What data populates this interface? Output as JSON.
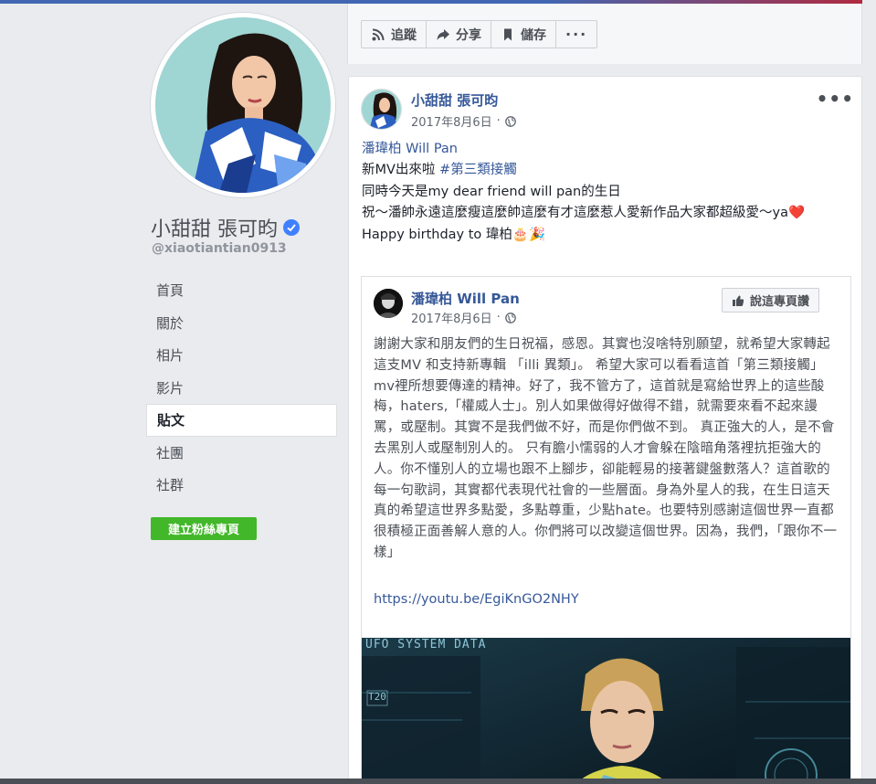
{
  "profile": {
    "name": "小甜甜 張可昀",
    "username": "@xiaotiantian0913"
  },
  "nav": {
    "items": [
      {
        "label": "首頁"
      },
      {
        "label": "關於"
      },
      {
        "label": "相片"
      },
      {
        "label": "影片"
      },
      {
        "label": "貼文"
      },
      {
        "label": "社團"
      },
      {
        "label": "社群"
      }
    ],
    "active_index": 4
  },
  "create_page_label": "建立粉絲專頁",
  "actions": {
    "follow": "追蹤",
    "share": "分享",
    "save": "儲存",
    "more": "···"
  },
  "post": {
    "author": "小甜甜 張可昀",
    "date": "2017年8月6日",
    "more": "•••",
    "lines": {
      "mention": "潘瑋柏 Will Pan",
      "l2a": "新MV出來啦 ",
      "l2b": "#第三類接觸",
      "l3": "同時今天是my dear friend will pan的生日",
      "l4": "祝～潘帥永遠這麼瘦這麼帥這麼有才這麼惹人愛新作品大家都超級愛～ya❤️",
      "l5": "Happy birthday to 瑋柏🎂🎉"
    }
  },
  "shared": {
    "author": "潘瑋柏 Will Pan",
    "date": "2017年8月6日",
    "like_label": "說這專頁讚",
    "body": "謝謝大家和朋友們的生日祝福，感恩。其實也沒啥特別願望，就希望大家轉起這支MV 和支持新專輯 「illi 異類」。 希望大家可以看看這首「第三類接觸」mv裡所想要傳達的精神。好了，我不管方了，這首就是寫給世界上的這些酸梅，haters,「權威人士」。別人如果做得好做得不錯，就需要來看不起來謾罵，或壓制。其實不是我們做不好，而是你們做不到。 真正強大的人，是不會去黑別人或壓制別人的。 只有膽小懦弱的人才會躲在陰暗角落裡抗拒強大的人。你不懂別人的立場也跟不上腳步，卻能輕易的接著鍵盤數落人？這首歌的每一句歌詞，其實都代表現代社會的一些層面。身為外星人的我，在生日這天真的希望這世界多點愛，多點尊重，少點hate。也要特別感謝這個世界一直都很積極正面善解人意的人。你們將可以改變這個世界。因為，我們，「跟你不一樣」",
    "link": "https://youtu.be/EgiKnGO2NHY"
  },
  "video": {
    "overlay_text": "UFO SYSTEM DATA",
    "hud_label": "T20"
  },
  "colors": {
    "brand_blue": "#4267b2",
    "link_blue": "#365899",
    "create_green": "#42b72a",
    "verified_blue": "#4080ff",
    "heart_red": "#e0245e"
  },
  "icons": {
    "follow": "rss-icon",
    "share": "share-arrow-icon",
    "save": "bookmark-icon",
    "verified": "verified-check-icon",
    "privacy": "globe-icon",
    "like": "thumbs-up-icon"
  }
}
